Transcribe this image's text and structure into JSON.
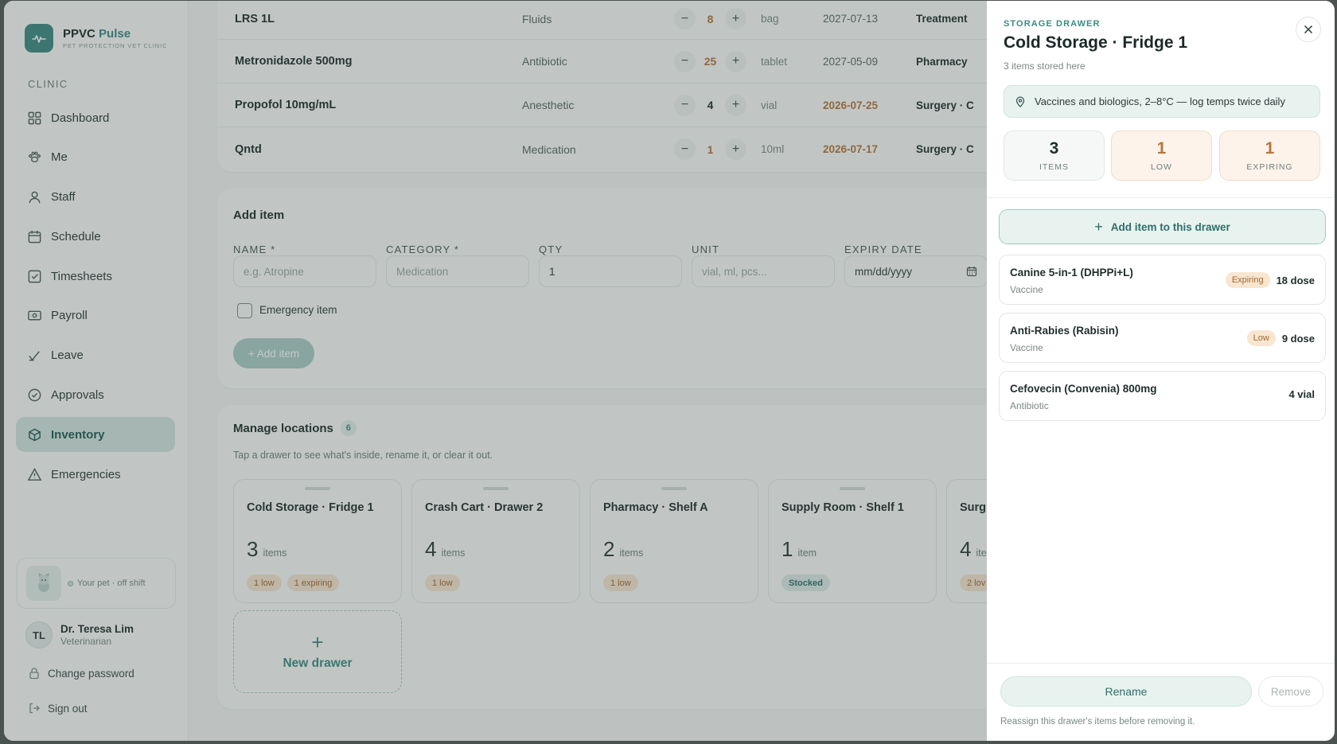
{
  "brand": {
    "name": "PPVC",
    "name_accent": "Pulse",
    "subtitle": "PET PROTECTION VET CLINIC"
  },
  "sidebar": {
    "section_label": "CLINIC",
    "items": [
      {
        "label": "Dashboard",
        "icon": "grid-icon"
      },
      {
        "label": "Me",
        "icon": "paw-icon"
      },
      {
        "label": "Staff",
        "icon": "user-icon"
      },
      {
        "label": "Schedule",
        "icon": "calendar-icon"
      },
      {
        "label": "Timesheets",
        "icon": "checkbox-icon"
      },
      {
        "label": "Payroll",
        "icon": "banknote-icon"
      },
      {
        "label": "Leave",
        "icon": "leave-icon"
      },
      {
        "label": "Approvals",
        "icon": "check-circle-icon"
      },
      {
        "label": "Inventory",
        "icon": "box-icon",
        "active": true
      },
      {
        "label": "Emergencies",
        "icon": "warning-icon"
      }
    ],
    "pet_status": "Your pet · off shift",
    "user": {
      "initials": "TL",
      "name": "Dr. Teresa Lim",
      "role": "Veterinarian"
    },
    "change_password": "Change password",
    "sign_out": "Sign out"
  },
  "inventory": {
    "rows": [
      {
        "name": "LRS 1L",
        "category": "Fluids",
        "qty": "8",
        "unit": "bag",
        "expiry": "2027-07-13",
        "expiry_warn": false,
        "location": "Treatment"
      },
      {
        "name": "Metronidazole 500mg",
        "category": "Antibiotic",
        "qty": "25",
        "unit": "tablet",
        "expiry": "2027-05-09",
        "expiry_warn": false,
        "location": "Pharmacy"
      },
      {
        "name": "Propofol 10mg/mL",
        "category": "Anesthetic",
        "qty": "4",
        "unit": "vial",
        "expiry": "2026-07-25",
        "expiry_warn": true,
        "location": "Surgery · C"
      },
      {
        "name": "Qntd",
        "category": "Medication",
        "qty": "1",
        "unit": "10ml",
        "expiry": "2026-07-17",
        "expiry_warn": true,
        "location": "Surgery · C"
      }
    ],
    "minus": "−",
    "plus": "+"
  },
  "add_item": {
    "title": "Add item",
    "fields": [
      {
        "label": "NAME *",
        "placeholder": "e.g. Atropine",
        "value": ""
      },
      {
        "label": "CATEGORY *",
        "placeholder": "Medication",
        "value": ""
      },
      {
        "label": "QTY",
        "placeholder": "",
        "value": "1"
      },
      {
        "label": "UNIT",
        "placeholder": "vial, ml, pcs...",
        "value": ""
      },
      {
        "label": "EXPIRY DATE",
        "placeholder": "mm/dd/yyyy",
        "value": ""
      }
    ],
    "emergency_label": "Emergency item",
    "button": "+ Add item"
  },
  "locations": {
    "title": "Manage locations",
    "count": "6",
    "hint": "Tap a drawer to see what's inside, rename it, or clear it out.",
    "drawers": [
      {
        "name": "Cold Storage · Fridge 1",
        "count": "3",
        "unit": "items",
        "badges": [
          {
            "text": "1 low",
            "kind": "warm"
          },
          {
            "text": "1 expiring",
            "kind": "warm"
          }
        ]
      },
      {
        "name": "Crash Cart · Drawer 2",
        "count": "4",
        "unit": "items",
        "badges": [
          {
            "text": "1 low",
            "kind": "warm"
          }
        ]
      },
      {
        "name": "Pharmacy · Shelf A",
        "count": "2",
        "unit": "items",
        "badges": [
          {
            "text": "1 low",
            "kind": "warm"
          }
        ]
      },
      {
        "name": "Supply Room · Shelf 1",
        "count": "1",
        "unit": "item",
        "badges": [
          {
            "text": "Stocked",
            "kind": "ok"
          }
        ]
      },
      {
        "name": "Surg",
        "count": "4",
        "unit": "ite",
        "badges": [
          {
            "text": "2 lov",
            "kind": "warm"
          }
        ]
      }
    ],
    "new_drawer": "New drawer",
    "new_drawer_plus": "+"
  },
  "panel": {
    "eyebrow": "STORAGE DRAWER",
    "title": "Cold Storage · Fridge 1",
    "subtitle": "3 items stored here",
    "note": "Vaccines and biologics, 2–8°C — log temps twice daily",
    "stats": [
      {
        "value": "3",
        "label": "ITEMS",
        "kind": "plain"
      },
      {
        "value": "1",
        "label": "LOW",
        "kind": "warm"
      },
      {
        "value": "1",
        "label": "EXPIRING",
        "kind": "warm"
      }
    ],
    "add_button": "Add item to this drawer",
    "items": [
      {
        "name": "Canine 5-in-1 (DHPPi+L)",
        "category": "Vaccine",
        "tag": "Expiring",
        "qty": "18 dose"
      },
      {
        "name": "Anti-Rabies (Rabisin)",
        "category": "Vaccine",
        "tag": "Low",
        "qty": "9 dose"
      },
      {
        "name": "Cefovecin (Convenia) 800mg",
        "category": "Antibiotic",
        "tag": "",
        "qty": "4 vial"
      }
    ],
    "rename": "Rename",
    "remove": "Remove",
    "hint": "Reassign this drawer's items before removing it."
  },
  "colors": {
    "accent": "#3e8a83",
    "warn": "#b8743a",
    "active_bg": "#d5e7e3"
  }
}
